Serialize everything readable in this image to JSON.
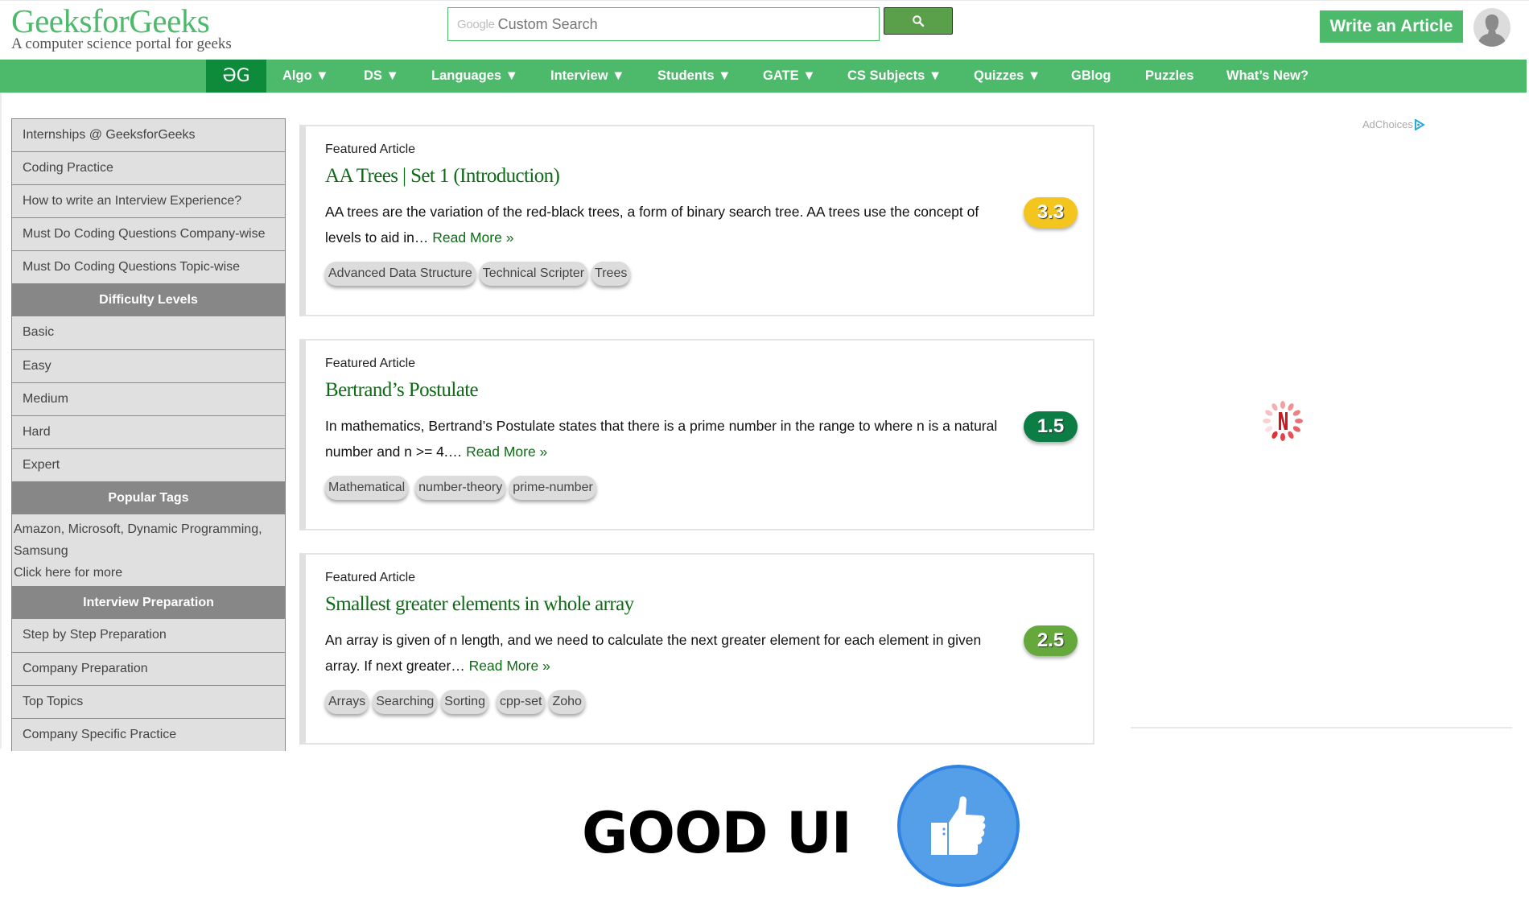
{
  "header": {
    "logo_title": "GeeksforGeeks",
    "logo_subtitle": "A computer science portal for geeks",
    "search": {
      "brand": "Google",
      "placeholder": "Custom Search",
      "value": ""
    },
    "search_button_icon": "search-icon",
    "write_article_label": "Write an Article",
    "avatar_icon": "user-avatar-icon"
  },
  "nav": {
    "home_label": "ƏG",
    "items": [
      {
        "label": "Algo ▼"
      },
      {
        "label": "DS ▼"
      },
      {
        "label": "Languages ▼"
      },
      {
        "label": "Interview ▼"
      },
      {
        "label": "Students ▼"
      },
      {
        "label": "GATE ▼"
      },
      {
        "label": "CS Subjects ▼"
      },
      {
        "label": "Quizzes ▼"
      },
      {
        "label": "GBlog"
      },
      {
        "label": "Puzzles"
      },
      {
        "label": "What’s New?"
      }
    ]
  },
  "sidebar": {
    "top_links": [
      "Internships @ GeeksforGeeks",
      "Coding Practice",
      "How to write an Interview Experience?",
      "Must Do Coding Questions Company-wise",
      "Must Do Coding Questions Topic-wise"
    ],
    "difficulty_heading": "Difficulty Levels",
    "difficulty_levels": [
      "Basic",
      "Easy",
      "Medium",
      "Hard",
      "Expert"
    ],
    "popular_tags_heading": "Popular Tags",
    "popular_tags_text": "Amazon, Microsoft, Dynamic Programming, Samsung",
    "popular_tags_more": "Click here for more",
    "interview_heading": "Interview Preparation",
    "interview_links": [
      "Step by Step Preparation",
      "Company Preparation",
      "Top Topics",
      "Company Specific Practice"
    ]
  },
  "articles": [
    {
      "label": "Featured Article",
      "title": "AA Trees | Set 1 (Introduction)",
      "excerpt": "AA trees are the variation of the red-black trees, a form of binary search tree. AA trees use the concept of levels to aid in… ",
      "read_more": "Read More »",
      "rating": "3.3",
      "rating_color": "#f4c51f",
      "tags": [
        "Advanced Data Structure",
        "Technical Scripter",
        "Trees"
      ]
    },
    {
      "label": "Featured Article",
      "title": "Bertrand’s Postulate",
      "excerpt": "In mathematics, Bertrand’s Postulate states that there is a prime number in the range to where n is a natural number and n >= 4.… ",
      "read_more": "Read More »",
      "rating": "1.5",
      "rating_color": "#0b7d45",
      "tags": [
        "Mathematical",
        "number-theory",
        "prime-number"
      ]
    },
    {
      "label": "Featured Article",
      "title": "Smallest greater elements in whole array",
      "excerpt": "An array is given of n length, and we need to calculate the next greater element for each element in given array. If next greater… ",
      "read_more": "Read More »",
      "rating": "2.5",
      "rating_color": "#65a83c",
      "tags": [
        "Arrays",
        "Searching",
        "Sorting",
        "cpp-set",
        "Zoho"
      ]
    }
  ],
  "ad": {
    "adchoices_label": "AdChoices",
    "loading_icon": "netflix-loading-spinner-icon"
  },
  "banner": {
    "text": "GOOD UI",
    "icon": "thumbs-up-icon"
  },
  "colors": {
    "brand_green": "#4cb96b",
    "brand_dark_green": "#0e8a3b",
    "link_green": "#0d6b16",
    "sidebar_bg": "#e0e0e0",
    "sidebar_heading_bg": "#878787",
    "thumb_blue": "#559ee8"
  }
}
